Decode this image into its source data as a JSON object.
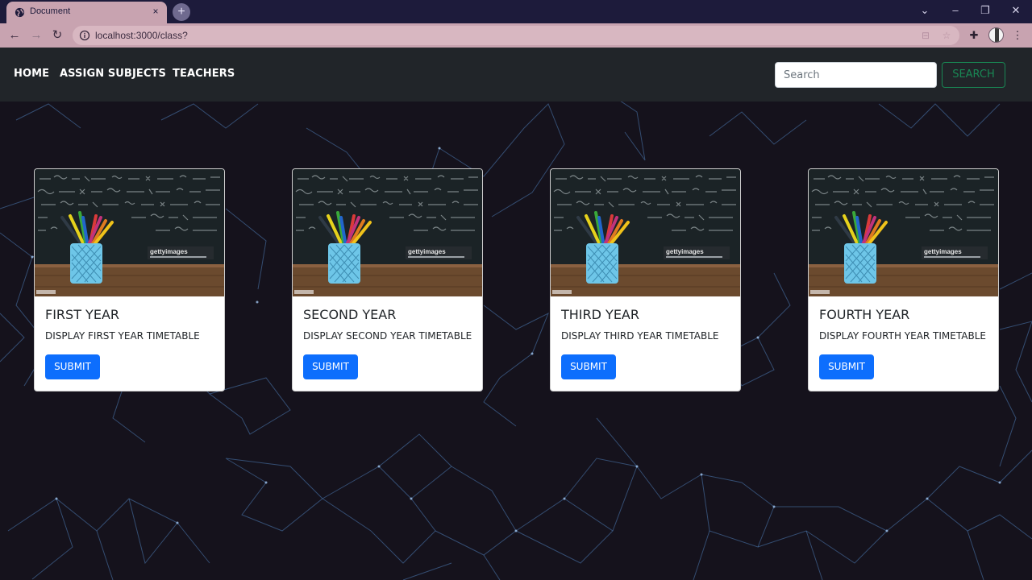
{
  "browser": {
    "tab_title": "Document",
    "tab_close": "×",
    "new_tab": "+",
    "url": "localhost:3000/class?"
  },
  "navbar": {
    "links": [
      "HOME",
      "ASSIGN SUBJECTS",
      "TEACHERS"
    ],
    "search_placeholder": "Search",
    "search_button": "SEARCH"
  },
  "cards": [
    {
      "title": "FIRST YEAR",
      "text": "DISPLAY FIRST YEAR TIMETABLE",
      "button": "SUBMIT"
    },
    {
      "title": "SECOND YEAR",
      "text": "DISPLAY SECOND YEAR TIMETABLE",
      "button": "SUBMIT"
    },
    {
      "title": "THIRD YEAR",
      "text": "DISPLAY THIRD YEAR TIMETABLE",
      "button": "SUBMIT"
    },
    {
      "title": "FOURTH YEAR",
      "text": "DISPLAY FOURTH YEAR TIMETABLE",
      "button": "SUBMIT"
    }
  ],
  "image_watermark": "gettyimages",
  "colors": {
    "tab_strip": "#1d1b3b",
    "toolbar": "#c8a3b0",
    "navbar": "#212529",
    "page_background": "#15121c",
    "network_lines": "#4f7db8",
    "search_button": "#198754",
    "primary_button": "#0d6efd"
  }
}
